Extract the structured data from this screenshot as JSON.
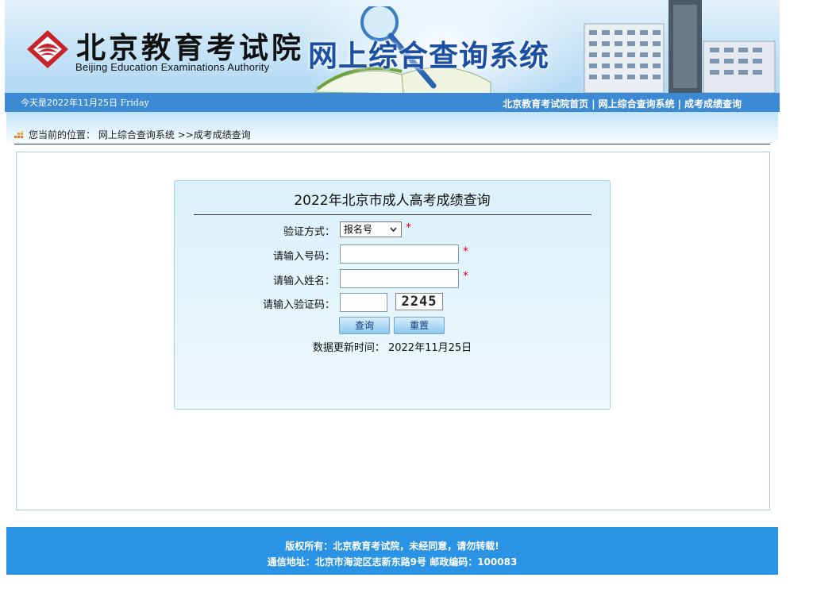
{
  "header": {
    "logo_cn": "北京教育考试院",
    "logo_en": "Beijing Education Examinations Authority",
    "system_title": "网上综合查询系统"
  },
  "navbar": {
    "date_prefix": "今天是2022年11月25日",
    "weekday": "Friday",
    "links": [
      "北京教育考试院首页",
      "网上综合查询系统",
      "成考成绩查询"
    ],
    "separator": "|"
  },
  "breadcrumb": {
    "label": "您当前的位置：",
    "path": "网上综合查询系统 >>成考成绩查询"
  },
  "form": {
    "title": "2022年北京市成人高考成绩查询",
    "verify_label": "验证方式：",
    "verify_value": "报名号",
    "number_label": "请输入号码：",
    "name_label": "请输入姓名：",
    "captcha_label": "请输入验证码：",
    "captcha_text": "2245",
    "required_mark": "*",
    "query_button": "查询",
    "reset_button": "重置",
    "updated_label": "数据更新时间：",
    "updated_value": "2022年11月25日"
  },
  "footer": {
    "copyright": "版权所有：北京教育考试院，未经同意，请勿转载!",
    "address": "通信地址：北京市海淀区志新东路9号 邮政编码：100083"
  },
  "colors": {
    "nav_blue": "#3d8ad4",
    "footer_blue": "#2b93e4",
    "title_blue": "#1a4fa4",
    "required_red": "#e0001b"
  }
}
